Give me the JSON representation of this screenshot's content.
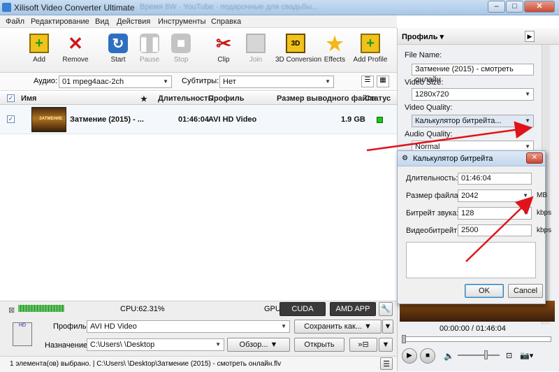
{
  "window": {
    "title": "Xilisoft Video Converter Ultimate",
    "background_tabs": "Время 8W · YouTube · подарочные для свадьбы..."
  },
  "menu": [
    "Файл",
    "Редактирование",
    "Вид",
    "Действия",
    "Инструменты",
    "Справка"
  ],
  "toolbar": {
    "add": "Add",
    "remove": "Remove",
    "start": "Start",
    "pause": "Pause",
    "stop": "Stop",
    "clip": "Clip",
    "join": "Join",
    "conv3d": "3D Conversion",
    "effects": "Effects",
    "add_profile": "Add Profile"
  },
  "options": {
    "audio_label": "Аудио:",
    "audio_value": "01 mpeg4aac-2ch",
    "subs_label": "Субтитры:",
    "subs_value": "Нет"
  },
  "columns": {
    "name": "Имя",
    "star": "★",
    "duration": "Длительность",
    "profile": "Профиль",
    "size": "Размер выводного файла",
    "status": "Статус"
  },
  "file": {
    "name": "Затмение (2015) - ...",
    "thumb_text": "ЗАТМЕНИЕ",
    "duration": "01:46:04",
    "profile": "AVI HD Video",
    "size": "1.9 GB"
  },
  "bottom": {
    "cpu": "CPU:62.31%",
    "gpu": "GPU:",
    "cuda": "CUDA",
    "amd": "AMD APP",
    "profile_label": "Профиль:",
    "profile_value": "AVI HD Video",
    "save_as": "Сохранить как...",
    "dest_label": "Назначение:",
    "dest_value": "C:\\Users\\ \\Desktop",
    "browse": "Обзор...",
    "open": "Открыть",
    "status": "1 элемента(ов) выбрано. | C:\\Users\\ \\Desktop\\Затмение (2015) - смотреть онлайн.flv"
  },
  "right": {
    "header": "Профиль",
    "file_name_label": "File Name:",
    "file_name": "Затмение (2015) - смотреть онлайн",
    "video_size_label": "Video Size:",
    "video_size": "1280x720",
    "video_quality_label": "Video Quality:",
    "video_quality": "Калькулятор битрейта...",
    "audio_quality_label": "Audio Quality:",
    "audio_quality": "Normal",
    "time": "00:00:00 / 01:46:04"
  },
  "dialog": {
    "title": "Калькулятор битрейта",
    "duration_label": "Длительность:",
    "duration": "01:46:04",
    "filesize_label": "Размер файла:",
    "filesize": "2042",
    "filesize_unit": "MB",
    "audio_label": "Битрейт звука:",
    "audio": "128",
    "audio_unit": "kbps",
    "video_label": "Видеобитрейт:",
    "video": "2500",
    "video_unit": "kbps",
    "ok": "OK",
    "cancel": "Cancel"
  },
  "colors": {
    "status_ok": "#1cc51c",
    "arrow": "#e0131a",
    "accent": "#3a7fd0"
  }
}
